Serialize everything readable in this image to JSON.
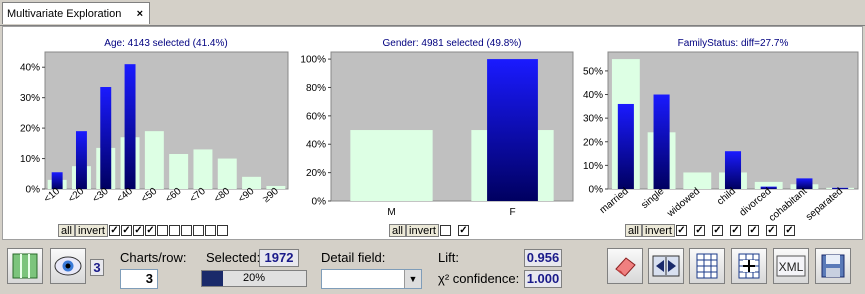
{
  "tab": {
    "title": "Multivariate Exploration",
    "close": "×"
  },
  "charts": [
    {
      "type": "bar",
      "title": "Age: 4143 selected (41.4%)",
      "categories": [
        "<10",
        "<20",
        "<30",
        "<40",
        "<50",
        "<60",
        "<70",
        "<80",
        "<90",
        "≥90"
      ],
      "series": [
        {
          "values": [
            3,
            7.5,
            13.5,
            17,
            19,
            11.5,
            13,
            10,
            4,
            1
          ]
        },
        {
          "values": [
            5.5,
            19,
            33.5,
            41,
            0,
            0,
            0,
            0,
            0,
            0
          ]
        }
      ],
      "yticks": [
        "0%",
        "10%",
        "20%",
        "30%",
        "40%"
      ],
      "ylim": [
        0,
        45
      ],
      "checks": [
        true,
        true,
        true,
        true,
        false,
        false,
        false,
        false,
        false,
        false
      ]
    },
    {
      "type": "bar",
      "title": "Gender: 4981 selected (49.8%)",
      "categories": [
        "M",
        "F"
      ],
      "series": [
        {
          "values": [
            50,
            50
          ]
        },
        {
          "values": [
            0,
            100
          ]
        }
      ],
      "yticks": [
        "0%",
        "20%",
        "40%",
        "60%",
        "80%",
        "100%"
      ],
      "ylim": [
        0,
        105
      ],
      "checks": [
        false,
        true
      ]
    },
    {
      "type": "bar",
      "title": "FamilyStatus: diff=27.7%",
      "categories": [
        "married",
        "single",
        "widowed",
        "child",
        "divorced",
        "cohabitant",
        "separated"
      ],
      "series": [
        {
          "values": [
            55,
            24,
            7,
            7,
            3,
            2,
            0.5
          ]
        },
        {
          "values": [
            36,
            40,
            0,
            16,
            1,
            4.5,
            0.5
          ]
        }
      ],
      "yticks": [
        "0%",
        "10%",
        "20%",
        "30%",
        "40%",
        "50%"
      ],
      "ylim": [
        0,
        58
      ],
      "checks": [
        true,
        true,
        true,
        true,
        true,
        true,
        true
      ]
    }
  ],
  "controls": {
    "all_label": "all",
    "invert_label": "invert"
  },
  "colors": {
    "plot_bg": "#c0c0c0",
    "base_bar": "#ddffe4",
    "sel_top": "#1a1aff",
    "sel_bottom": "#000060",
    "title": "#000080"
  },
  "bottom": {
    "count_badge": "3",
    "charts_per_row_label": "Charts/row:",
    "charts_per_row_value": "3",
    "selected_label": "Selected:",
    "selected_value": "1972",
    "progress": 0.2,
    "progress_label": "20%",
    "detail_label": "Detail field:",
    "detail_value": "",
    "lift_label": "Lift:",
    "lift_value": "0.956",
    "conf_label": "χ² confidence:",
    "conf_value": "1.000",
    "tools": [
      "columns-icon",
      "eye-icon",
      "eraser-icon",
      "split-icon",
      "table-icon",
      "add-table-icon",
      "xml-icon",
      "save-icon"
    ]
  }
}
